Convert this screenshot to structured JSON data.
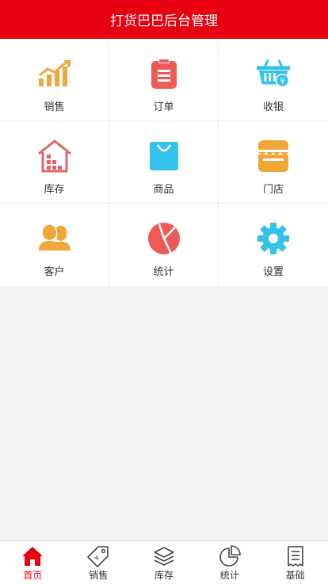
{
  "header": {
    "title": "打货巴巴后台管理"
  },
  "menu": {
    "items": [
      {
        "label": "销售",
        "icon": "sales-chart-icon",
        "color": "#f0a73a"
      },
      {
        "label": "订单",
        "icon": "clipboard-icon",
        "color": "#ee5b57"
      },
      {
        "label": "收银",
        "icon": "basket-icon",
        "color": "#33c2ea"
      },
      {
        "label": "库存",
        "icon": "warehouse-icon",
        "color": "#e0646a"
      },
      {
        "label": "商品",
        "icon": "shopping-bag-icon",
        "color": "#33c2ea"
      },
      {
        "label": "门店",
        "icon": "storefront-icon",
        "color": "#f0a73a"
      },
      {
        "label": "客户",
        "icon": "customers-icon",
        "color": "#f0a73a"
      },
      {
        "label": "统计",
        "icon": "pie-chart-icon",
        "color": "#ee5b57"
      },
      {
        "label": "设置",
        "icon": "gear-icon",
        "color": "#33c2ea"
      }
    ]
  },
  "tabbar": {
    "active_color": "#e60012",
    "tabs": [
      {
        "label": "首页",
        "icon": "home-icon",
        "active": true
      },
      {
        "label": "销售",
        "icon": "price-tag-icon",
        "active": false
      },
      {
        "label": "库存",
        "icon": "layers-icon",
        "active": false
      },
      {
        "label": "统计",
        "icon": "pie-chart-icon",
        "active": false
      },
      {
        "label": "基础",
        "icon": "document-icon",
        "active": false
      }
    ]
  }
}
